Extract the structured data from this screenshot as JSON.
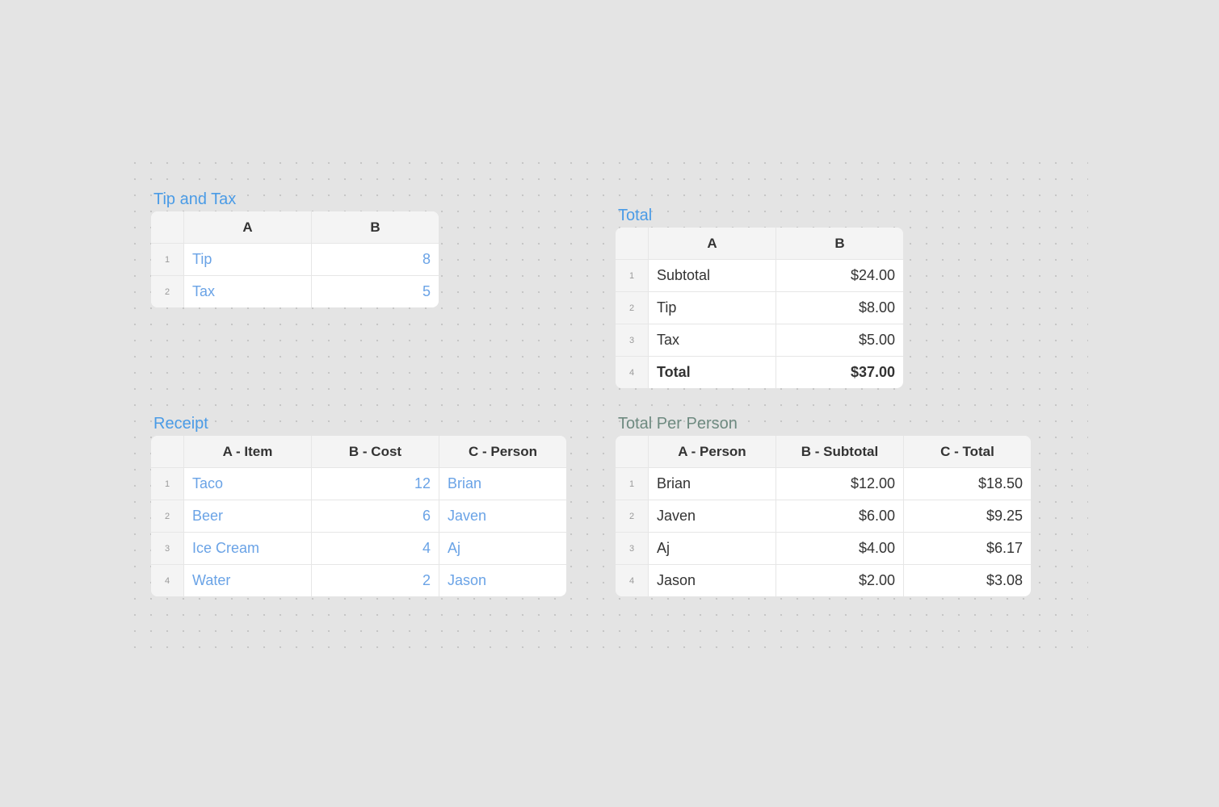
{
  "sheets": {
    "tip_tax": {
      "title": "Tip and Tax",
      "headers": [
        "A",
        "B"
      ],
      "rows": [
        {
          "num": "1",
          "a": "Tip",
          "b": "8"
        },
        {
          "num": "2",
          "a": "Tax",
          "b": "5"
        }
      ]
    },
    "total": {
      "title": "Total",
      "headers": [
        "A",
        "B"
      ],
      "rows": [
        {
          "num": "1",
          "a": "Subtotal",
          "b": "$24.00"
        },
        {
          "num": "2",
          "a": "Tip",
          "b": "$8.00"
        },
        {
          "num": "3",
          "a": "Tax",
          "b": "$5.00"
        },
        {
          "num": "4",
          "a": "Total",
          "b": "$37.00"
        }
      ]
    },
    "receipt": {
      "title": "Receipt",
      "headers": [
        "A - Item",
        "B - Cost",
        "C - Person"
      ],
      "rows": [
        {
          "num": "1",
          "a": "Taco",
          "b": "12",
          "c": "Brian"
        },
        {
          "num": "2",
          "a": "Beer",
          "b": "6",
          "c": "Javen"
        },
        {
          "num": "3",
          "a": "Ice Cream",
          "b": "4",
          "c": "Aj"
        },
        {
          "num": "4",
          "a": "Water",
          "b": "2",
          "c": "Jason"
        }
      ]
    },
    "per_person": {
      "title": "Total Per Person",
      "headers": [
        "A - Person",
        "B - Subtotal",
        "C - Total"
      ],
      "rows": [
        {
          "num": "1",
          "a": "Brian",
          "b": "$12.00",
          "c": "$18.50"
        },
        {
          "num": "2",
          "a": "Javen",
          "b": "$6.00",
          "c": "$9.25"
        },
        {
          "num": "3",
          "a": "Aj",
          "b": "$4.00",
          "c": "$6.17"
        },
        {
          "num": "4",
          "a": "Jason",
          "b": "$2.00",
          "c": "$3.08"
        }
      ]
    }
  },
  "colors": {
    "input_text": "#6aa3e6",
    "title_blue": "#4a9be6",
    "title_green": "#6e8a80"
  }
}
